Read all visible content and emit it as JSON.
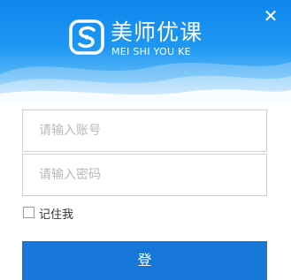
{
  "colors": {
    "header_top": "#0f86ee",
    "header_bottom": "#bfe1fb",
    "button": "#1677d9",
    "field_border": "#cfcfcf",
    "placeholder": "#b9b9b9"
  },
  "window": {
    "close_icon": "close-icon",
    "close_glyph": "✕"
  },
  "brand": {
    "name": "美师优课",
    "subtitle": "MEI SHI YOU KE",
    "logo_icon": "brand-logo-icon"
  },
  "form": {
    "account_placeholder": "请输入账号",
    "password_placeholder": "请输入密码",
    "remember_label": "记住我",
    "remember_checked": false,
    "login_label": "登"
  }
}
